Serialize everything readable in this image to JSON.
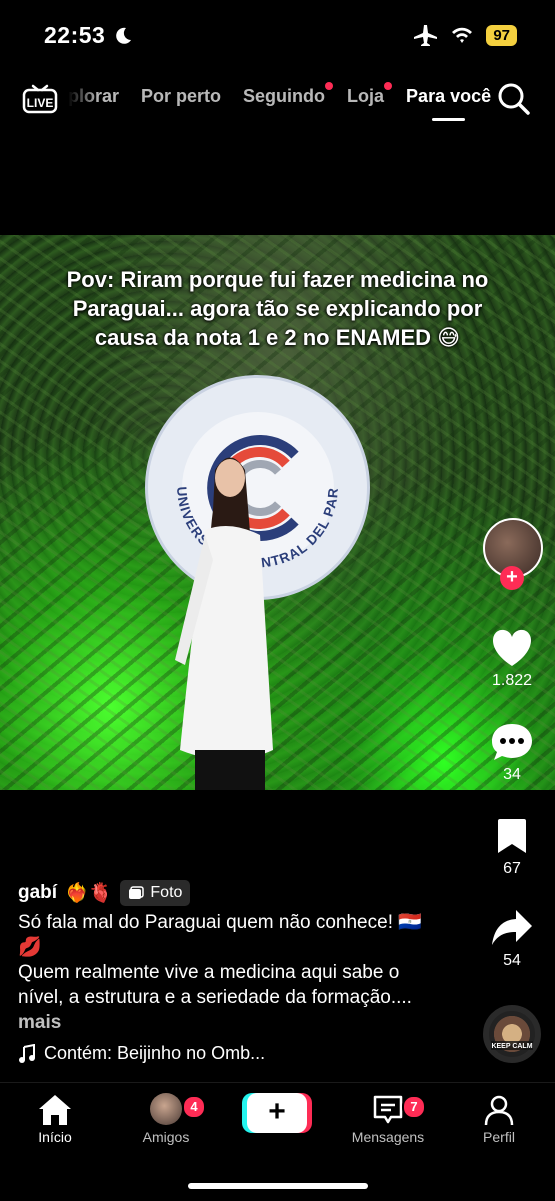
{
  "status_bar": {
    "time": "22:53",
    "battery": "97"
  },
  "top_nav": {
    "live_label": "LIVE",
    "tabs": [
      {
        "label": "Explorar",
        "visible_text": "plorar",
        "dot": false
      },
      {
        "label": "Por perto",
        "dot": false
      },
      {
        "label": "Seguindo",
        "dot": true
      },
      {
        "label": "Loja",
        "dot": true
      },
      {
        "label": "Para você",
        "dot": false,
        "active": true
      }
    ]
  },
  "post": {
    "caption_overlay": "Pov: Riram porque fui fazer medicina no Paraguai... agora tão se explicando por causa da nota 1 e 2 no ENAMED 😅",
    "seal_text": "UNIVERSIDAD CENTRAL DEL PARAGUAY",
    "author": "gabí",
    "author_emojis": "❤️‍🔥🫀",
    "type_badge": "Foto",
    "description_line1": "Só fala mal do Paraguai quem não conhece! 🇵🇾 💋",
    "description_line2": "Quem realmente vive a medicina aqui sabe o nível, a estrutura e a seriedade da formação....",
    "more_label": "mais",
    "music": "Contém: Beijinho no Omb..."
  },
  "rail": {
    "likes": "1.822",
    "comments": "34",
    "saves": "67",
    "shares": "54",
    "music_disc_text": "KEEP CALM"
  },
  "bottom_nav": {
    "home": "Início",
    "friends": "Amigos",
    "friends_badge": "4",
    "create": "+",
    "messages": "Mensagens",
    "messages_badge": "7",
    "profile": "Perfil"
  },
  "colors": {
    "accent_red": "#fe2c55",
    "accent_cyan": "#25f4ee",
    "battery": "#f4d03f"
  }
}
